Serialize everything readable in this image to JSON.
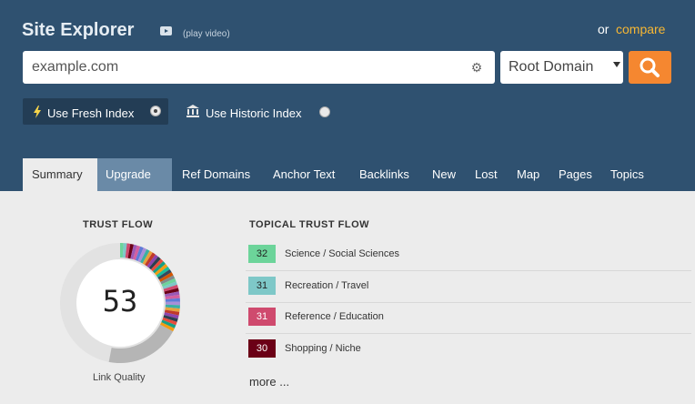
{
  "header": {
    "title": "Site Explorer",
    "play_video": "(play video)",
    "or_text": "or",
    "compare": "compare"
  },
  "search": {
    "value": "example.com",
    "scope": "Root Domain"
  },
  "index": {
    "fresh": "Use Fresh Index",
    "historic": "Use Historic Index",
    "selected": "fresh"
  },
  "tabs": [
    {
      "label": "Summary",
      "active": true
    },
    {
      "label": "Upgrade"
    },
    {
      "label": "Ref Domains"
    },
    {
      "label": "Anchor Text"
    },
    {
      "label": "Backlinks"
    },
    {
      "label": "New"
    },
    {
      "label": "Lost"
    },
    {
      "label": "Map"
    },
    {
      "label": "Pages"
    },
    {
      "label": "Topics"
    }
  ],
  "trust_flow": {
    "title": "TRUST FLOW",
    "value": "53",
    "caption": "Link Quality",
    "level": 53
  },
  "topical": {
    "title": "TOPICAL TRUST FLOW",
    "items": [
      {
        "value": "32",
        "label": "Science / Social Sciences",
        "color": "#6cd49a"
      },
      {
        "value": "31",
        "label": "Recreation / Travel",
        "color": "#7ec8c8"
      },
      {
        "value": "31",
        "label": "Reference / Education",
        "color": "#cf4a6e"
      },
      {
        "value": "30",
        "label": "Shopping / Niche",
        "color": "#6b0016"
      }
    ],
    "more": "more ..."
  },
  "colors": {
    "header_bg": "#2f5170",
    "accent": "#f58730",
    "compare_link": "#f7b733"
  },
  "icons": [
    "play-icon",
    "gear-icon",
    "search-icon",
    "bolt-icon",
    "bank-icon"
  ]
}
